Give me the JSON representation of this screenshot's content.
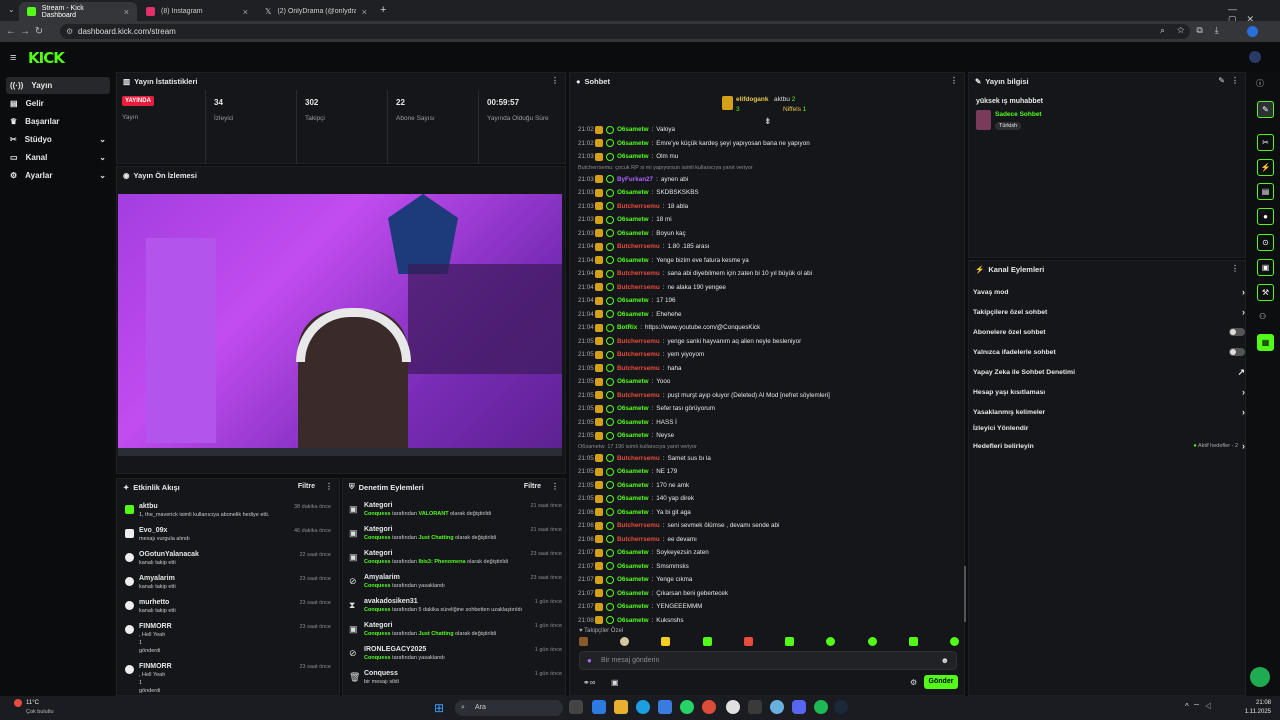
{
  "browser": {
    "tabs": [
      {
        "title": "Stream - Kick Dashboard",
        "color": "#53fc18"
      },
      {
        "title": "(8) Instagram",
        "color": "#e1306c"
      },
      {
        "title": "(2) OnlyDrama (@onlydramaX)",
        "color": "#ffffff"
      }
    ],
    "url": "dashboard.kick.com/stream"
  },
  "brand": {
    "logo": "KICK",
    "accent": "#53fc18"
  },
  "sidebar": {
    "items": [
      {
        "label": "Yayın",
        "icon": "broadcast-icon"
      },
      {
        "label": "Gelir",
        "icon": "wallet-icon"
      },
      {
        "label": "Başarılar",
        "icon": "trophy-icon"
      },
      {
        "label": "Stüdyo",
        "icon": "studio-icon"
      },
      {
        "label": "Kanal",
        "icon": "channel-icon"
      },
      {
        "label": "Ayarlar",
        "icon": "gear-icon"
      }
    ]
  },
  "stats": {
    "title": "Yayın İstatistikleri",
    "live_badge": "YAYINDA",
    "live_label": "Yayın",
    "items": [
      {
        "value": "34",
        "label": "İzleyici"
      },
      {
        "value": "302",
        "label": "Takipçi"
      },
      {
        "value": "22",
        "label": "Abone Sayısı"
      },
      {
        "value": "00:59:57",
        "label": "Yayında Olduğu Süre"
      }
    ]
  },
  "preview": {
    "title": "Yayın Ön İzlemesi"
  },
  "activity": {
    "title": "Etkinlik Akışı",
    "filter": "Filtre",
    "items": [
      {
        "name": "aktbu",
        "sub": "1, the_maverick isimli kullanıcıya abonelik hediye etti.",
        "time": "38 dakika önce"
      },
      {
        "name": "Evo_09x",
        "sub": "mesajı vurgula alındı",
        "time": "46 dakika önce"
      },
      {
        "name": "OGotunYalanacak",
        "sub": "kanalı takip etti",
        "time": "22 saat önce"
      },
      {
        "name": "Amyalarim",
        "sub": "kanalı takip etti",
        "time": "23 saat önce"
      },
      {
        "name": "murhetto",
        "sub": "kanalı takip etti",
        "time": "23 saat önce"
      },
      {
        "name": "FINMORR",
        "sub": ", Hell Yeah",
        "extra": "1",
        "extra2": "gönderdi",
        "time": "23 saat önce"
      },
      {
        "name": "FINMORR",
        "sub": ", Hell Yeah",
        "extra": "1",
        "extra2": "gönderdi",
        "time": "23 saat önce"
      }
    ]
  },
  "moderation": {
    "title": "Denetim Eylemleri",
    "filter": "Filtre",
    "items": [
      {
        "name": "Kategori",
        "actor": "Conquess",
        "text": "tarafından",
        "hl": "VALORANT",
        "tail": "olarak değiştirildi",
        "time": "21 saat önce"
      },
      {
        "name": "Kategori",
        "actor": "Conquess",
        "text": "tarafından",
        "hl": "Just Chatting",
        "tail": "olarak değiştirildi",
        "time": "21 saat önce"
      },
      {
        "name": "Kategori",
        "actor": "Conquess",
        "text": "tarafından",
        "hl": "Ibis3: Phenomena",
        "tail": "olarak değiştirildi",
        "time": "23 saat önce"
      },
      {
        "name": "Amyalarim",
        "actor": "Conquess",
        "text": "tarafından yasaklandı",
        "hl": "",
        "tail": "",
        "time": "23 saat önce"
      },
      {
        "name": "avakadosiken31",
        "actor": "Conquess",
        "text": "tarafından 5 dakika süreliğine sohbetten uzaklaştırıldı",
        "hl": "",
        "tail": "",
        "time": "1 gün önce"
      },
      {
        "name": "Kategori",
        "actor": "Conquess",
        "text": "tarafından",
        "hl": "Just Chatting",
        "tail": "olarak değiştirildi",
        "time": "1 gün önce"
      },
      {
        "name": "IRONLEGACY2025",
        "actor": "Conquess",
        "text": "tarafından yasaklandı",
        "hl": "",
        "tail": "",
        "time": "1 gün önce"
      },
      {
        "name": "Conquess",
        "actor": "",
        "text": "bir mesajı sildi",
        "hl": "",
        "tail": "",
        "time": "1 gün önce"
      }
    ]
  },
  "chat": {
    "title": "Sohbet",
    "top": [
      {
        "name": "elifdogank",
        "count": ""
      },
      {
        "name": "aktbu",
        "count": "2"
      },
      {
        "name": "",
        "count": "3"
      },
      {
        "name": "Niffels",
        "count": "1"
      }
    ],
    "messages": [
      {
        "t": "21:02",
        "u": "O6sametw",
        "c": "u1",
        "m": "Valoya"
      },
      {
        "t": "21:02",
        "u": "O6sametw",
        "c": "u1",
        "m": "Emre'ye küçük kardeş şeyi yapıyosan bana ne yapıyon"
      },
      {
        "t": "21:03",
        "u": "O6sametw",
        "c": "u1",
        "m": "Olm mu"
      },
      {
        "sys": "Butcherrsemu: çocuk RP si mi yapıyorsun isimli kullanıcıya yanıt veriyor"
      },
      {
        "t": "21:03",
        "u": "ByFurkan27",
        "c": "u3",
        "m": "aynen abi"
      },
      {
        "t": "21:03",
        "u": "O6sametw",
        "c": "u1",
        "m": "SKDBSKSKBS"
      },
      {
        "t": "21:03",
        "u": "Butcherrsemu",
        "c": "u2",
        "m": "18 abla"
      },
      {
        "t": "21:03",
        "u": "O6sametw",
        "c": "u1",
        "m": "18 mi"
      },
      {
        "t": "21:03",
        "u": "O6sametw",
        "c": "u1",
        "m": "Boyun kaç"
      },
      {
        "t": "21:04",
        "u": "Butcherrsemu",
        "c": "u2",
        "m": "1.80 .185 arası"
      },
      {
        "t": "21:04",
        "u": "O6sametw",
        "c": "u1",
        "m": "Yenge bizim eve fatura kesme ya"
      },
      {
        "t": "21:04",
        "u": "Butcherrsemu",
        "c": "u2",
        "m": "sana abi diyebilmem için zaten bi 10 yıl büyük ol abi"
      },
      {
        "t": "21:04",
        "u": "Butcherrsemu",
        "c": "u2",
        "m": "ne alaka 190 yengee"
      },
      {
        "t": "21:04",
        "u": "O6sametw",
        "c": "u1",
        "m": "17 196"
      },
      {
        "t": "21:04",
        "u": "O6sametw",
        "c": "u1",
        "m": "Ehehehe"
      },
      {
        "t": "21:04",
        "u": "BotRix",
        "c": "u1",
        "m": "https://www.youtube.com/@ConquesKick"
      },
      {
        "t": "21:05",
        "u": "Butcherrsemu",
        "c": "u2",
        "m": "yenge sanki hayvanım aq alien neyle besleniyor"
      },
      {
        "t": "21:05",
        "u": "Butcherrsemu",
        "c": "u2",
        "m": "yem yiyoyom"
      },
      {
        "t": "21:05",
        "u": "Butcherrsemu",
        "c": "u2",
        "m": "haha"
      },
      {
        "t": "21:05",
        "u": "O6sametw",
        "c": "u1",
        "m": "Yooo"
      },
      {
        "t": "21:05",
        "u": "Butcherrsemu",
        "c": "u2",
        "m": "puşt murşt ayıp oluyor (Deleted) AI Mod [nefret söylemleri]"
      },
      {
        "t": "21:05",
        "u": "O6sametw",
        "c": "u1",
        "m": "Sefer tası görüyorum"
      },
      {
        "t": "21:05",
        "u": "O6sametw",
        "c": "u1",
        "m": "HASS İ"
      },
      {
        "t": "21:05",
        "u": "O6sametw",
        "c": "u1",
        "m": "Neyse"
      },
      {
        "sys": "O6sametw: 17 196 isimli kullanıcıya yanıt veriyor"
      },
      {
        "t": "21:05",
        "u": "Butcherrsemu",
        "c": "u2",
        "m": "Samet sus bı la"
      },
      {
        "t": "21:05",
        "u": "O6sametw",
        "c": "u1",
        "m": "NE 179"
      },
      {
        "t": "21:05",
        "u": "O6sametw",
        "c": "u1",
        "m": "170 ne amk"
      },
      {
        "t": "21:05",
        "u": "O6sametw",
        "c": "u1",
        "m": "140 yap direk"
      },
      {
        "t": "21:06",
        "u": "O6sametw",
        "c": "u1",
        "m": "Ya bi git aga"
      },
      {
        "t": "21:06",
        "u": "Butcherrsemu",
        "c": "u2",
        "m": "seni sevmek ölümse , devamı sende abi"
      },
      {
        "t": "21:06",
        "u": "Butcherrsemu",
        "c": "u2",
        "m": "ee devamı"
      },
      {
        "t": "21:07",
        "u": "O6sametw",
        "c": "u1",
        "m": "Soykeyezsin zaten"
      },
      {
        "t": "21:07",
        "u": "O6sametw",
        "c": "u1",
        "m": "Smsmmsks"
      },
      {
        "t": "21:07",
        "u": "O6sametw",
        "c": "u1",
        "m": "Yenge cıkma"
      },
      {
        "t": "21:07",
        "u": "O6sametw",
        "c": "u1",
        "m": "Çıkarsan beni gebertecek"
      },
      {
        "t": "21:07",
        "u": "O6sametw",
        "c": "u1",
        "m": "YENGEEEMMM"
      },
      {
        "t": "21:08",
        "u": "O6sametw",
        "c": "u1",
        "m": "Kuksnshs"
      }
    ],
    "followers_only": "Takipçiler Özel",
    "placeholder": "Bir mesaj gönderin",
    "send": "Gönder"
  },
  "stream_info": {
    "title": "Yayın bilgisi",
    "stream_title": "yüksek ış muhabbet",
    "category": "Sadece Sohbet",
    "tag": "Türkish"
  },
  "channel_actions": {
    "title": "Kanal Eylemleri",
    "items": [
      {
        "label": "Yavaş mod",
        "ctl": "›"
      },
      {
        "label": "Takipçilere özel sohbet",
        "ctl": "›"
      },
      {
        "label": "Abonelere özel sohbet",
        "ctl": "toggle"
      },
      {
        "label": "Yalnızca ifadelerle sohbet",
        "ctl": "toggle"
      },
      {
        "label": "Yapay Zeka ile Sohbet Denetimi",
        "ctl": "↗"
      },
      {
        "label": "Hesap yaşı kısıtlaması",
        "ctl": "›"
      },
      {
        "label": "Yasaklanmış kelimeler",
        "ctl": "›"
      },
      {
        "label": "İzleyici Yönlendir",
        "ctl": ""
      },
      {
        "label": "Hedefleri belirleyin",
        "ctl": "›",
        "badge": "Aktif hedefler - 2"
      }
    ]
  },
  "taskbar": {
    "weather": "11°C",
    "weather_sub": "Çok bulutlu",
    "search": "Ara",
    "time": "21:08",
    "date": "1.11.2025"
  }
}
